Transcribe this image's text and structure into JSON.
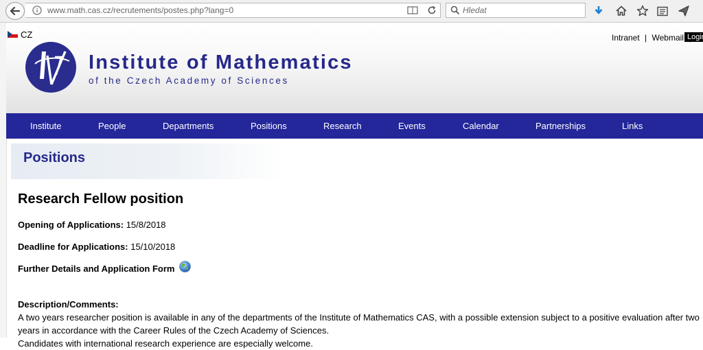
{
  "browser": {
    "url": "www.math.cas.cz/recrutements/postes.php?lang=0",
    "search_placeholder": "Hledat"
  },
  "header": {
    "lang": "CZ",
    "intranet": "Intranet",
    "webmail": "Webmail",
    "separator": "|",
    "login": "Login",
    "title": "Institute of Mathematics",
    "subtitle": "of the Czech Academy of Sciences"
  },
  "nav": {
    "items": [
      "Institute",
      "People",
      "Departments",
      "Positions",
      "Research",
      "Events",
      "Calendar",
      "Partnerships",
      "Links"
    ]
  },
  "main": {
    "section_title": "Positions",
    "job_title": "Research Fellow position",
    "opening_label": "Opening of Applications:",
    "opening_value": "15/8/2018",
    "deadline_label": "Deadline for Applications:",
    "deadline_value": "15/10/2018",
    "details_label": "Further Details and Application Form",
    "desc_label": "Description/Comments:",
    "desc_text1": "A two years researcher position is available in any of the departments of the Institute of Mathematics CAS, with a possible extension subject to a positive evaluation after two years in accordance with the Career Rules of the Czech Academy of Sciences.",
    "desc_text2": "Candidates with international research experience are especially welcome."
  },
  "colors": {
    "brand_blue": "#26288a",
    "nav_blue": "#24279a"
  }
}
